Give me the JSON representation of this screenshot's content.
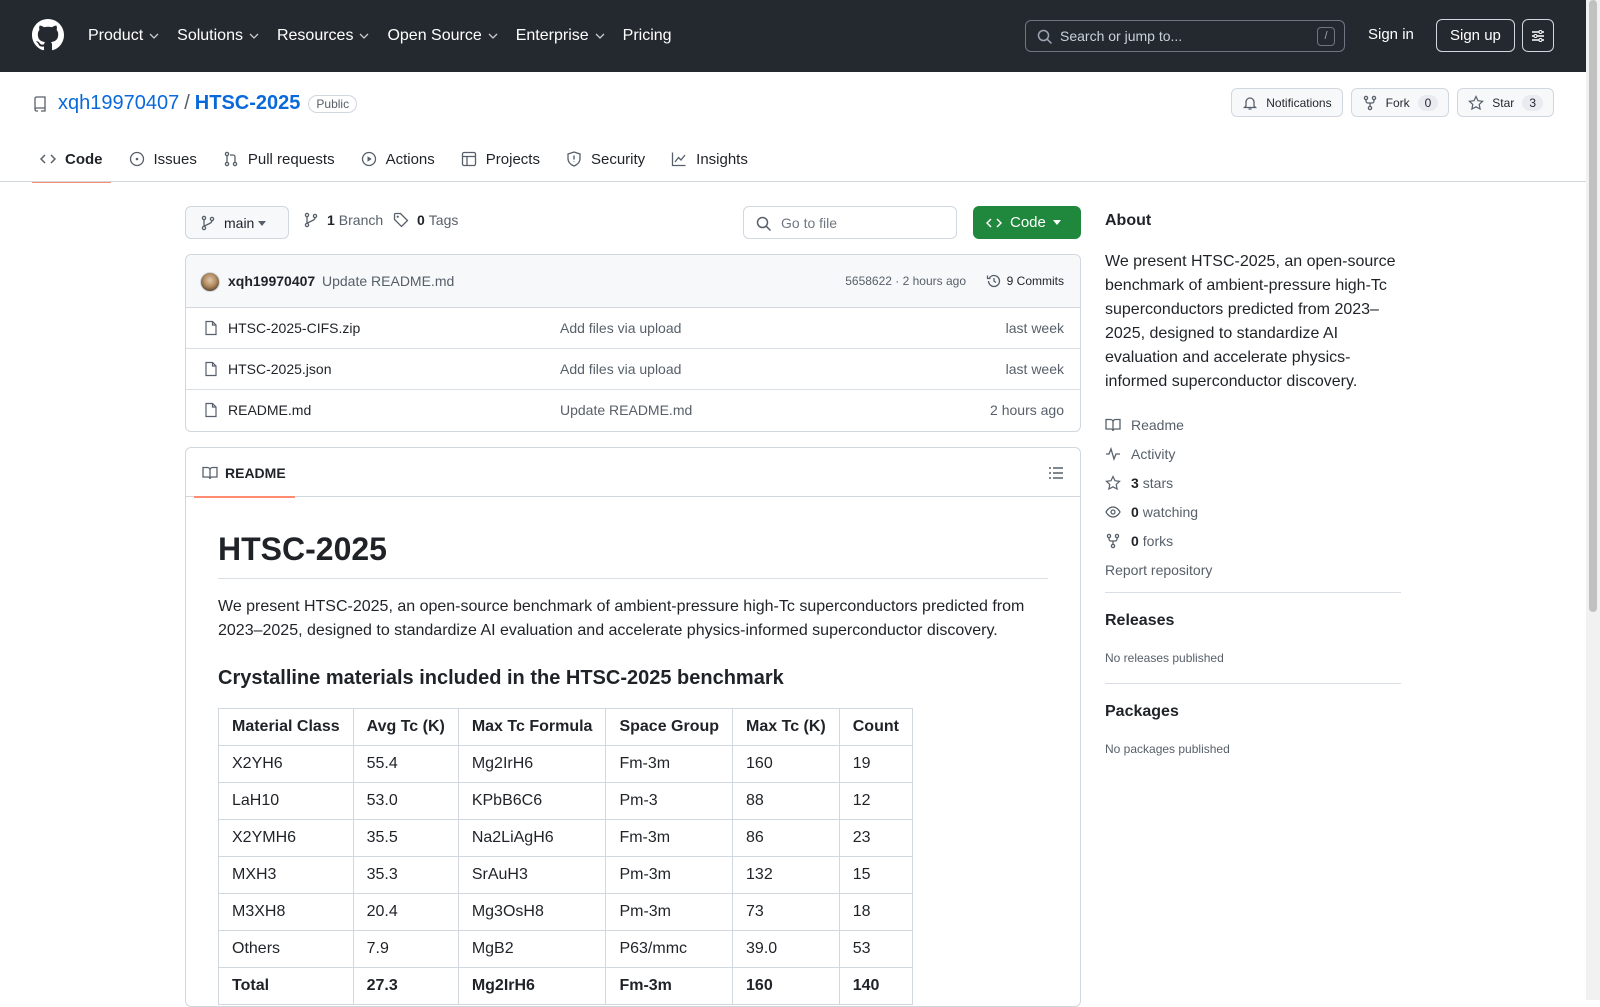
{
  "header": {
    "nav": [
      {
        "label": "Product",
        "has_menu": true
      },
      {
        "label": "Solutions",
        "has_menu": true
      },
      {
        "label": "Resources",
        "has_menu": true
      },
      {
        "label": "Open Source",
        "has_menu": true
      },
      {
        "label": "Enterprise",
        "has_menu": true
      },
      {
        "label": "Pricing",
        "has_menu": false
      }
    ],
    "search_placeholder": "Search or jump to...",
    "search_shortcut": "/",
    "sign_in": "Sign in",
    "sign_up": "Sign up"
  },
  "repo": {
    "owner": "xqh19970407",
    "separator": "/",
    "name": "HTSC-2025",
    "visibility": "Public",
    "notifications_label": "Notifications",
    "fork_label": "Fork",
    "fork_count": "0",
    "star_label": "Star",
    "star_count": "3"
  },
  "tabs": [
    {
      "label": "Code",
      "icon": "code-icon",
      "active": true
    },
    {
      "label": "Issues",
      "icon": "issue-icon",
      "active": false
    },
    {
      "label": "Pull requests",
      "icon": "pull-request-icon",
      "active": false
    },
    {
      "label": "Actions",
      "icon": "play-icon",
      "active": false
    },
    {
      "label": "Projects",
      "icon": "table-icon",
      "active": false
    },
    {
      "label": "Security",
      "icon": "shield-icon",
      "active": false
    },
    {
      "label": "Insights",
      "icon": "graph-icon",
      "active": false
    }
  ],
  "toolbar": {
    "branch": "main",
    "branch_count": "1",
    "branch_label": "Branch",
    "tag_count": "0",
    "tag_label": "Tags",
    "goto_placeholder": "Go to file",
    "code_button": "Code"
  },
  "commit": {
    "author": "xqh19970407",
    "message": "Update README.md",
    "meta": "5658622 · 2 hours ago",
    "count_label": "9 Commits"
  },
  "files": [
    {
      "name": "HTSC-2025-CIFS.zip",
      "message": "Add files via upload",
      "date": "last week"
    },
    {
      "name": "HTSC-2025.json",
      "message": "Add files via upload",
      "date": "last week"
    },
    {
      "name": "README.md",
      "message": "Update README.md",
      "date": "2 hours ago"
    }
  ],
  "readme": {
    "tab_label": "README",
    "title": "HTSC-2025",
    "intro": "We present HTSC-2025, an open-source benchmark of ambient-pressure high-Tc superconductors predicted from 2023–2025, designed to standardize AI evaluation and accelerate physics-informed superconductor discovery.",
    "section_title": "Crystalline materials included in the HTSC-2025 benchmark",
    "table": {
      "headers": [
        "Material Class",
        "Avg Tc (K)",
        "Max Tc Formula",
        "Space Group",
        "Max Tc (K)",
        "Count"
      ],
      "rows": [
        [
          "X2YH6",
          "55.4",
          "Mg2IrH6",
          "Fm-3m",
          "160",
          "19"
        ],
        [
          "LaH10",
          "53.0",
          "KPbB6C6",
          "Pm-3",
          "88",
          "12"
        ],
        [
          "X2YMH6",
          "35.5",
          "Na2LiAgH6",
          "Fm-3m",
          "86",
          "23"
        ],
        [
          "MXH3",
          "35.3",
          "SrAuH3",
          "Pm-3m",
          "132",
          "15"
        ],
        [
          "M3XH8",
          "20.4",
          "Mg3OsH8",
          "Pm-3m",
          "73",
          "18"
        ],
        [
          "Others",
          "7.9",
          "MgB2",
          "P63/mmc",
          "39.0",
          "53"
        ]
      ],
      "total": [
        "Total",
        "27.3",
        "Mg2IrH6",
        "Fm-3m",
        "160",
        "140"
      ]
    }
  },
  "about": {
    "title": "About",
    "description": "We present HTSC-2025, an open-source benchmark of ambient-pressure high-Tc superconductors predicted from 2023–2025, designed to standardize AI evaluation and accelerate physics-informed superconductor discovery.",
    "readme": "Readme",
    "activity": "Activity",
    "stars_count": "3",
    "stars_label": "stars",
    "watching_count": "0",
    "watching_label": "watching",
    "forks_count": "0",
    "forks_label": "forks",
    "report": "Report repository"
  },
  "releases": {
    "title": "Releases",
    "empty": "No releases published"
  },
  "packages": {
    "title": "Packages",
    "empty": "No packages published"
  }
}
